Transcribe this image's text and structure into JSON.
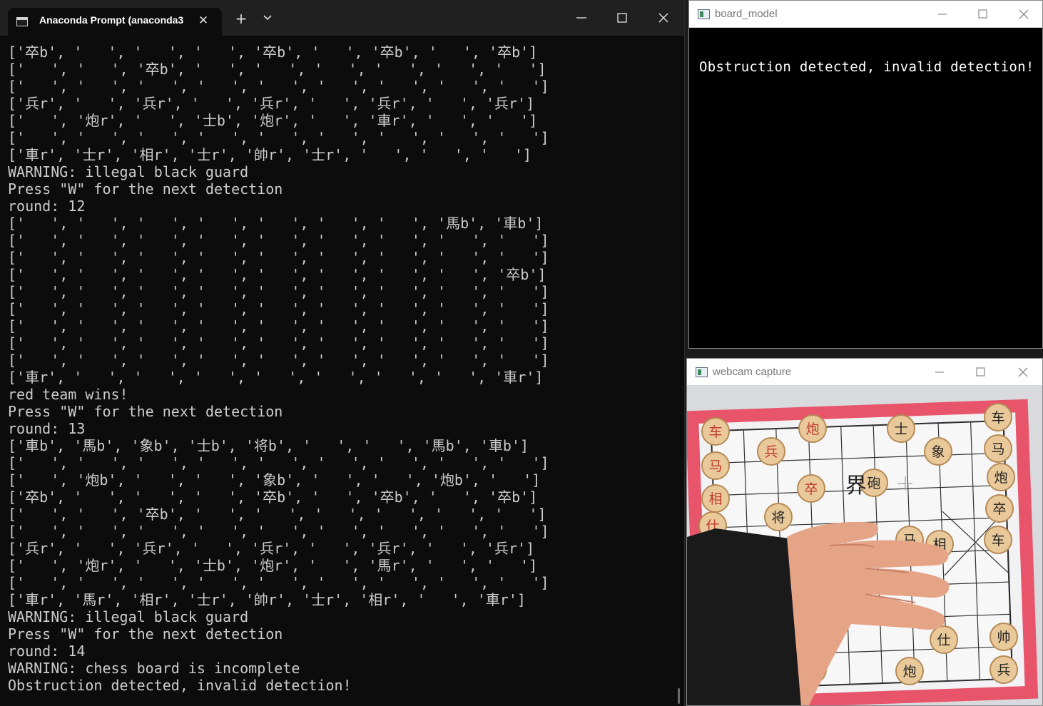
{
  "terminal": {
    "tab_title": "Anaconda Prompt (anaconda3",
    "tab_icon": "terminal-icon",
    "new_tab_symbol": "+",
    "lines": [
      "['卒b', '   ', '   ', '   ', '卒b', '   ', '卒b', '   ', '卒b']",
      "['   ', '   ', '卒b', '   ', '   ', '   ', '   ', '   ', '   ']",
      "['   ', '   ', '   ', '   ', '   ', '   ', '   ', '   ', '   ']",
      "['兵r', '   ', '兵r', '   ', '兵r', '   ', '兵r', '   ', '兵r']",
      "['   ', '炮r', '   ', '士b', '炮r', '   ', '車r', '   ', '   ']",
      "['   ', '   ', '   ', '   ', '   ', '   ', '   ', '   ', '   ']",
      "['車r', '士r', '相r', '士r', '帥r', '士r', '   ', '   ', '   ']",
      "WARNING: illegal black guard",
      "Press \"W\" for the next detection",
      "round: 12",
      "['   ', '   ', '   ', '   ', '   ', '   ', '   ', '馬b', '車b']",
      "['   ', '   ', '   ', '   ', '   ', '   ', '   ', '   ', '   ']",
      "['   ', '   ', '   ', '   ', '   ', '   ', '   ', '   ', '   ']",
      "['   ', '   ', '   ', '   ', '   ', '   ', '   ', '   ', '卒b']",
      "['   ', '   ', '   ', '   ', '   ', '   ', '   ', '   ', '   ']",
      "['   ', '   ', '   ', '   ', '   ', '   ', '   ', '   ', '   ']",
      "['   ', '   ', '   ', '   ', '   ', '   ', '   ', '   ', '   ']",
      "['   ', '   ', '   ', '   ', '   ', '   ', '   ', '   ', '   ']",
      "['   ', '   ', '   ', '   ', '   ', '   ', '   ', '   ', '   ']",
      "['車r', '   ', '   ', '   ', '   ', '   ', '   ', '   ', '車r']",
      "red team wins!",
      "Press \"W\" for the next detection",
      "round: 13",
      "['車b', '馬b', '象b', '士b', '将b', '   ', '   ', '馬b', '車b']",
      "['   ', '   ', '   ', '   ', '   ', '   ', '   ', '   ', '   ']",
      "['   ', '炮b', '   ', '   ', '象b', '   ', '   ', '炮b', '   ']",
      "['卒b', '   ', '   ', '   ', '卒b', '   ', '卒b', '   ', '卒b']",
      "['   ', '   ', '卒b', '   ', '   ', '   ', '   ', '   ', '   ']",
      "['   ', '   ', '   ', '   ', '   ', '   ', '   ', '   ', '   ']",
      "['兵r', '   ', '兵r', '   ', '兵r', '   ', '兵r', '   ', '兵r']",
      "['   ', '炮r', '   ', '士b', '炮r', '   ', '馬r', '   ', '   ']",
      "['   ', '   ', '   ', '   ', '   ', '   ', '   ', '   ', '   ']",
      "['車r', '馬r', '相r', '士r', '帥r', '士r', '相r', '   ', '車r']",
      "WARNING: illegal black guard",
      "Press \"W\" for the next detection",
      "round: 14",
      "WARNING: chess board is incomplete",
      "Obstruction detected, invalid detection!"
    ]
  },
  "board_window": {
    "title": "board_model",
    "message": "Obstruction detected, invalid detection!"
  },
  "webcam_window": {
    "title": "webcam capture",
    "board_center_text": "界",
    "pieces": [
      "车",
      "马",
      "相",
      "仕",
      "帅",
      "兵",
      "炮",
      "卒",
      "将",
      "士",
      "象",
      "砲",
      "车",
      "马",
      "炮",
      "卒"
    ],
    "colors": {
      "board_border": "#e8546a",
      "piece": "#e9c99a",
      "red_text": "#c0392b",
      "black_text": "#222222",
      "skin": "#e6a487",
      "sleeve": "#1a1a1a"
    }
  }
}
